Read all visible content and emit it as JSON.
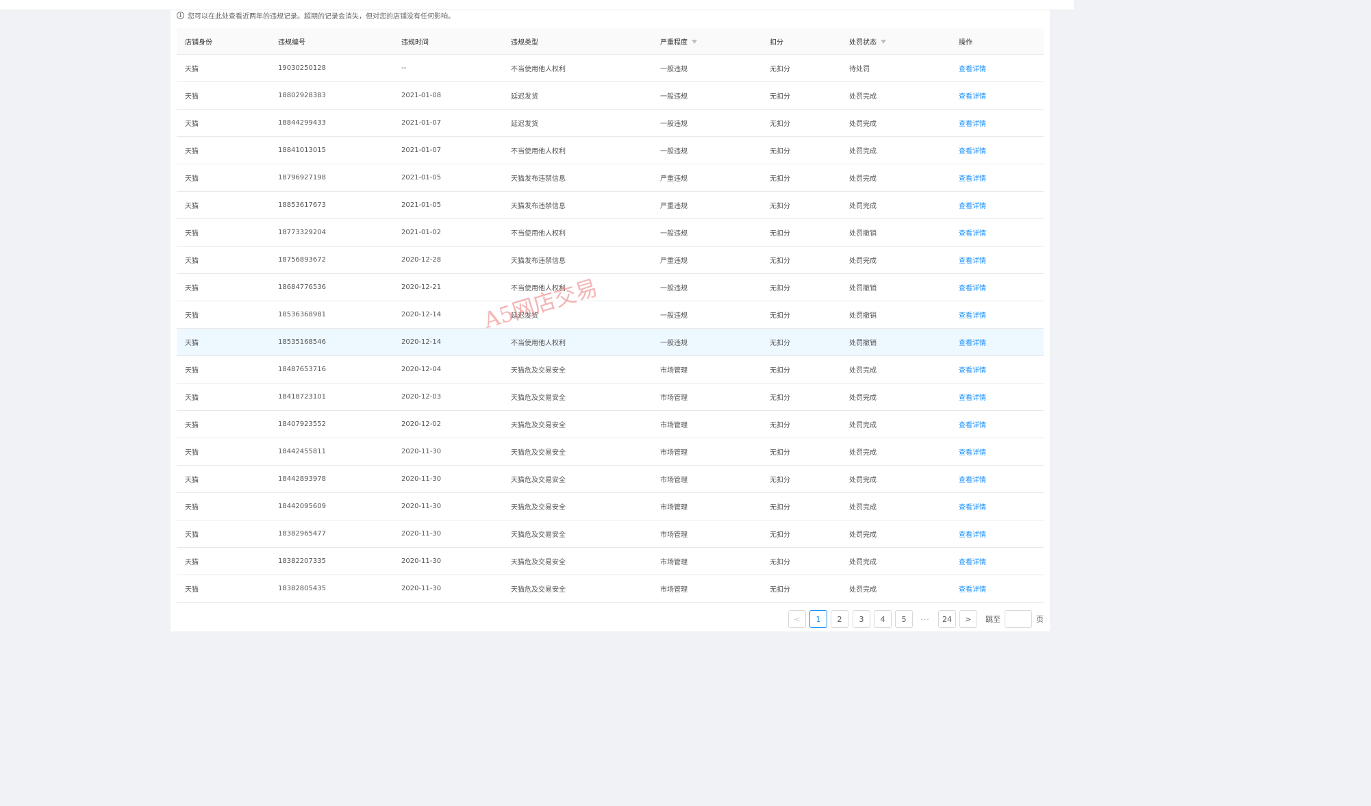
{
  "notice": {
    "icon": "info-icon",
    "text": "您可以在此处查看近两年的违规记录。超期的记录会消失，但对您的店铺没有任何影响。"
  },
  "table": {
    "headers": {
      "shop": "店铺身份",
      "id": "违规编号",
      "time": "违规时间",
      "type": "违规类型",
      "severity": "严重程度",
      "points": "扣分",
      "status": "处罚状态",
      "action": "操作"
    },
    "rows": [
      {
        "shop": "天猫",
        "id": "19030250128",
        "time": "--",
        "type": "不当使用他人权利",
        "severity": "一般违规",
        "points": "无扣分",
        "status": "待处罚",
        "action": "查看详情"
      },
      {
        "shop": "天猫",
        "id": "18802928383",
        "time": "2021-01-08",
        "type": "延迟发货",
        "severity": "一般违规",
        "points": "无扣分",
        "status": "处罚完成",
        "action": "查看详情"
      },
      {
        "shop": "天猫",
        "id": "18844299433",
        "time": "2021-01-07",
        "type": "延迟发货",
        "severity": "一般违规",
        "points": "无扣分",
        "status": "处罚完成",
        "action": "查看详情"
      },
      {
        "shop": "天猫",
        "id": "18841013015",
        "time": "2021-01-07",
        "type": "不当使用他人权利",
        "severity": "一般违规",
        "points": "无扣分",
        "status": "处罚完成",
        "action": "查看详情"
      },
      {
        "shop": "天猫",
        "id": "18796927198",
        "time": "2021-01-05",
        "type": "天猫发布违禁信息",
        "severity": "严重违规",
        "points": "无扣分",
        "status": "处罚完成",
        "action": "查看详情"
      },
      {
        "shop": "天猫",
        "id": "18853617673",
        "time": "2021-01-05",
        "type": "天猫发布违禁信息",
        "severity": "严重违规",
        "points": "无扣分",
        "status": "处罚完成",
        "action": "查看详情"
      },
      {
        "shop": "天猫",
        "id": "18773329204",
        "time": "2021-01-02",
        "type": "不当使用他人权利",
        "severity": "一般违规",
        "points": "无扣分",
        "status": "处罚撤销",
        "action": "查看详情"
      },
      {
        "shop": "天猫",
        "id": "18756893672",
        "time": "2020-12-28",
        "type": "天猫发布违禁信息",
        "severity": "严重违规",
        "points": "无扣分",
        "status": "处罚完成",
        "action": "查看详情"
      },
      {
        "shop": "天猫",
        "id": "18684776536",
        "time": "2020-12-21",
        "type": "不当使用他人权利",
        "severity": "一般违规",
        "points": "无扣分",
        "status": "处罚撤销",
        "action": "查看详情"
      },
      {
        "shop": "天猫",
        "id": "18536368981",
        "time": "2020-12-14",
        "type": "延迟发货",
        "severity": "一般违规",
        "points": "无扣分",
        "status": "处罚撤销",
        "action": "查看详情"
      },
      {
        "shop": "天猫",
        "id": "18535168546",
        "time": "2020-12-14",
        "type": "不当使用他人权利",
        "severity": "一般违规",
        "points": "无扣分",
        "status": "处罚撤销",
        "action": "查看详情"
      },
      {
        "shop": "天猫",
        "id": "18487653716",
        "time": "2020-12-04",
        "type": "天猫危及交易安全",
        "severity": "市场管理",
        "points": "无扣分",
        "status": "处罚完成",
        "action": "查看详情"
      },
      {
        "shop": "天猫",
        "id": "18418723101",
        "time": "2020-12-03",
        "type": "天猫危及交易安全",
        "severity": "市场管理",
        "points": "无扣分",
        "status": "处罚完成",
        "action": "查看详情"
      },
      {
        "shop": "天猫",
        "id": "18407923552",
        "time": "2020-12-02",
        "type": "天猫危及交易安全",
        "severity": "市场管理",
        "points": "无扣分",
        "status": "处罚完成",
        "action": "查看详情"
      },
      {
        "shop": "天猫",
        "id": "18442455811",
        "time": "2020-11-30",
        "type": "天猫危及交易安全",
        "severity": "市场管理",
        "points": "无扣分",
        "status": "处罚完成",
        "action": "查看详情"
      },
      {
        "shop": "天猫",
        "id": "18442893978",
        "time": "2020-11-30",
        "type": "天猫危及交易安全",
        "severity": "市场管理",
        "points": "无扣分",
        "status": "处罚完成",
        "action": "查看详情"
      },
      {
        "shop": "天猫",
        "id": "18442095609",
        "time": "2020-11-30",
        "type": "天猫危及交易安全",
        "severity": "市场管理",
        "points": "无扣分",
        "status": "处罚完成",
        "action": "查看详情"
      },
      {
        "shop": "天猫",
        "id": "18382965477",
        "time": "2020-11-30",
        "type": "天猫危及交易安全",
        "severity": "市场管理",
        "points": "无扣分",
        "status": "处罚完成",
        "action": "查看详情"
      },
      {
        "shop": "天猫",
        "id": "18382207335",
        "time": "2020-11-30",
        "type": "天猫危及交易安全",
        "severity": "市场管理",
        "points": "无扣分",
        "status": "处罚完成",
        "action": "查看详情"
      },
      {
        "shop": "天猫",
        "id": "18382805435",
        "time": "2020-11-30",
        "type": "天猫危及交易安全",
        "severity": "市场管理",
        "points": "无扣分",
        "status": "处罚完成",
        "action": "查看详情"
      }
    ],
    "highlighted_row": 10,
    "filter_icon": "filter-icon"
  },
  "watermark": "A5网店交易",
  "pagination": {
    "prev": "<",
    "pages": [
      "1",
      "2",
      "3",
      "4",
      "5"
    ],
    "ellipsis": "···",
    "last": "24",
    "next": ">",
    "current": "1",
    "jump_label": "跳至",
    "jump_value": "",
    "page_suffix": "页"
  },
  "colors": {
    "link": "#1890ff",
    "highlight_row": "#eef8ff",
    "watermark": "#e85a5a"
  }
}
